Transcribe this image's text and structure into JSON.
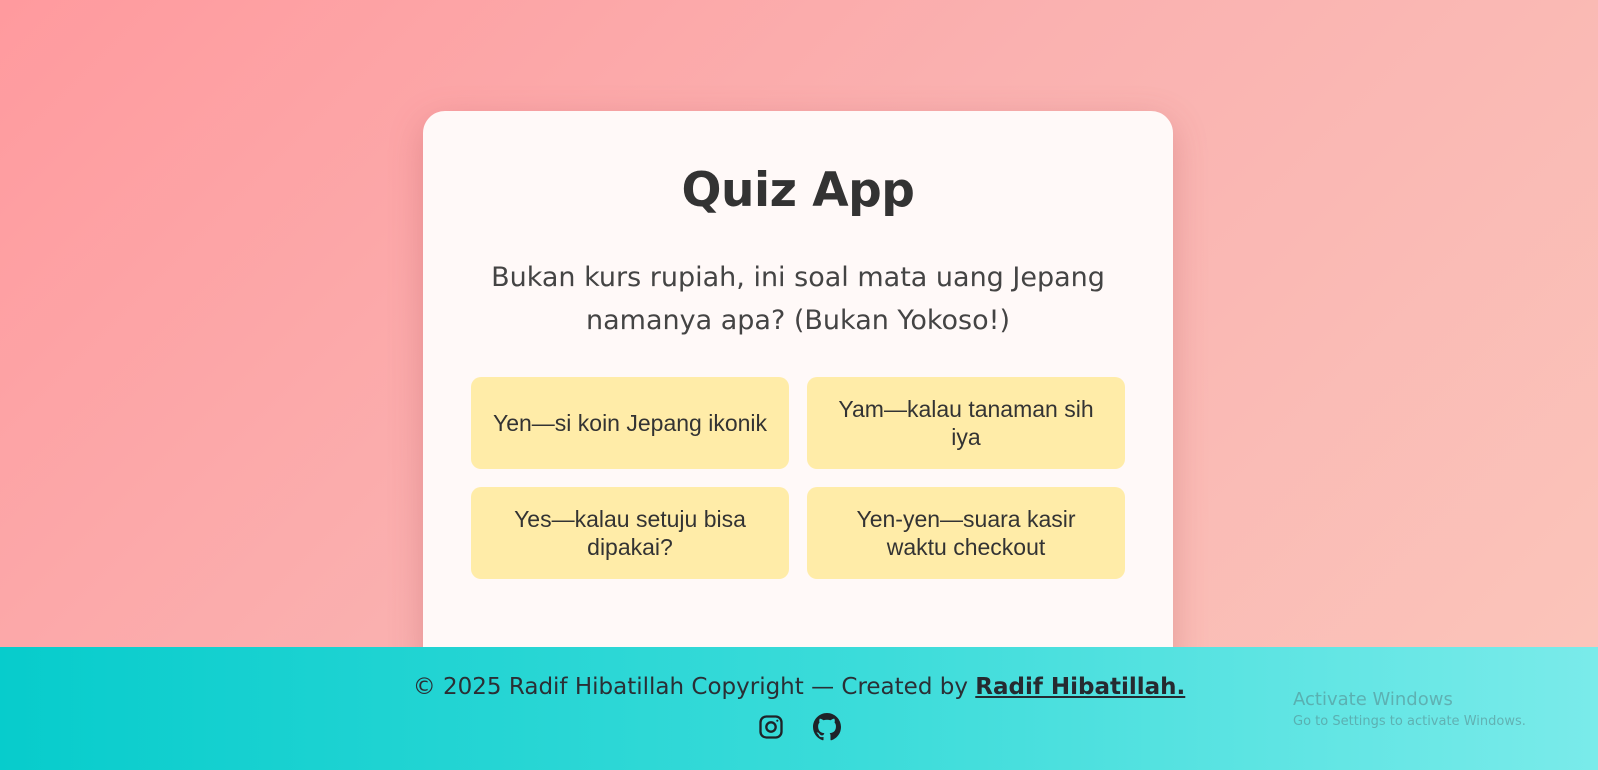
{
  "app": {
    "title": "Quiz App"
  },
  "quiz": {
    "question": "Bukan kurs rupiah, ini soal mata uang Jepang namanya apa? (Bukan Yokoso!)",
    "answers": [
      "Yen—si koin Jepang ikonik",
      "Yam—kalau tanaman sih iya",
      "Yes—kalau setuju bisa dipakai?",
      "Yen-yen—suara kasir waktu checkout"
    ]
  },
  "footer": {
    "copyright": "© 2025 Radif Hibatillah Copyright — Created by ",
    "author": "Radif Hibatillah.",
    "social": [
      {
        "icon": "instagram-icon"
      },
      {
        "icon": "github-icon"
      }
    ]
  },
  "watermark": {
    "line1": "Activate Windows",
    "line2": "Go to Settings to activate Windows."
  },
  "colors": {
    "background_start": "#ff9a9e",
    "background_end": "#fbc6bb",
    "card": "#fff9f8",
    "answer_button": "#ffeca8",
    "footer_start": "#07cccc",
    "footer_end": "#7aebea",
    "text": "#333333"
  }
}
